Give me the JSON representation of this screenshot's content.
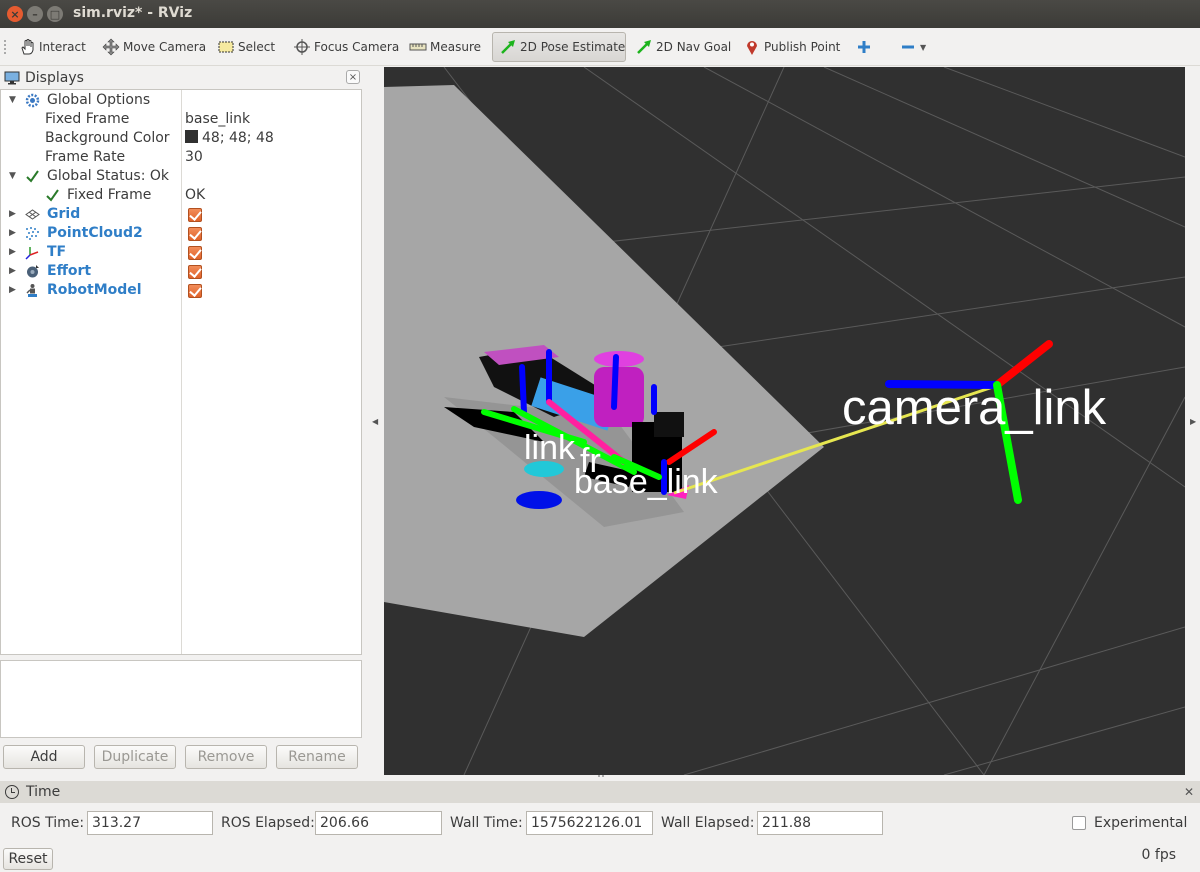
{
  "window": {
    "title": "sim.rviz* - RViz"
  },
  "toolbar": {
    "tools": [
      {
        "label": "Interact",
        "icon": "hand-icon"
      },
      {
        "label": "Move Camera",
        "icon": "move-camera-icon"
      },
      {
        "label": "Select",
        "icon": "select-box-icon"
      },
      {
        "label": "Focus Camera",
        "icon": "focus-camera-icon"
      },
      {
        "label": "Measure",
        "icon": "ruler-icon"
      },
      {
        "label": "2D Pose Estimate",
        "icon": "green-arrow-icon",
        "active": true
      },
      {
        "label": "2D Nav Goal",
        "icon": "green-arrow-icon"
      },
      {
        "label": "Publish Point",
        "icon": "map-pin-icon"
      }
    ]
  },
  "displays": {
    "title": "Displays",
    "rows": [
      {
        "name": "Global Options",
        "icon": "gear-icon",
        "expanded": true
      },
      {
        "name": "Fixed Frame",
        "value": "base_link"
      },
      {
        "name": "Background Color",
        "value": "48; 48; 48",
        "color": "#303030"
      },
      {
        "name": "Frame Rate",
        "value": "30"
      },
      {
        "name": "Global Status: Ok",
        "icon": "check-icon",
        "expanded": true
      },
      {
        "name": "Fixed Frame",
        "value": "OK",
        "icon": "check-icon"
      },
      {
        "name": "Grid",
        "icon": "grid-icon",
        "checked": true
      },
      {
        "name": "PointCloud2",
        "icon": "pointcloud-icon",
        "checked": true
      },
      {
        "name": "TF",
        "icon": "tf-axes-icon",
        "checked": true
      },
      {
        "name": "Effort",
        "icon": "effort-icon",
        "checked": true
      },
      {
        "name": "RobotModel",
        "icon": "robot-icon",
        "checked": true
      }
    ],
    "buttons": {
      "add": "Add",
      "duplicate": "Duplicate",
      "remove": "Remove",
      "rename": "Rename"
    }
  },
  "view3d": {
    "labels": {
      "camera_link": "camera_link",
      "base_link": "base_link",
      "link": "link",
      "fr": "fr"
    },
    "background": "#303030"
  },
  "time": {
    "title": "Time",
    "ros_time_label": "ROS Time:",
    "ros_time": "313.27",
    "ros_elapsed_label": "ROS Elapsed:",
    "ros_elapsed": "206.66",
    "wall_time_label": "Wall Time:",
    "wall_time": "1575622126.01",
    "wall_elapsed_label": "Wall Elapsed:",
    "wall_elapsed": "211.88",
    "experimental_label": "Experimental",
    "experimental_checked": false
  },
  "status": {
    "reset_label": "Reset",
    "fps": "0 fps"
  }
}
